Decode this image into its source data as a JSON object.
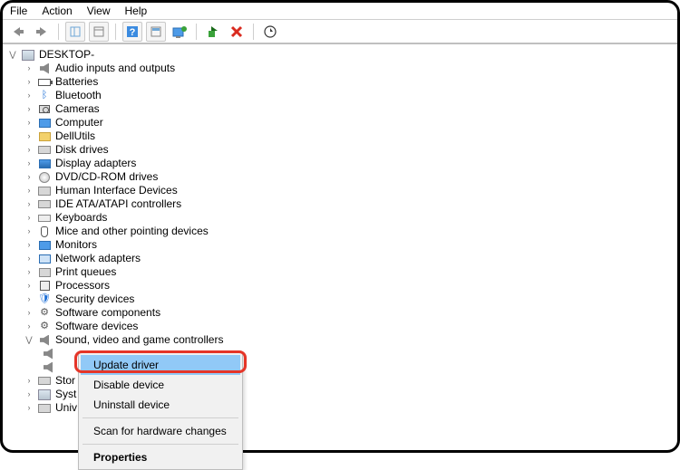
{
  "menubar": {
    "file": "File",
    "action": "Action",
    "view": "View",
    "help": "Help"
  },
  "root": "DESKTOP-",
  "categories": [
    "Audio inputs and outputs",
    "Batteries",
    "Bluetooth",
    "Cameras",
    "Computer",
    "DellUtils",
    "Disk drives",
    "Display adapters",
    "DVD/CD-ROM drives",
    "Human Interface Devices",
    "IDE ATA/ATAPI controllers",
    "Keyboards",
    "Mice and other pointing devices",
    "Monitors",
    "Network adapters",
    "Print queues",
    "Processors",
    "Security devices",
    "Software components",
    "Software devices",
    "Sound, video and game controllers"
  ],
  "truncated": [
    "Stor",
    "Syst",
    "Univ"
  ],
  "context_menu": {
    "update": "Update driver",
    "disable": "Disable device",
    "uninstall": "Uninstall device",
    "scan": "Scan for hardware changes",
    "properties": "Properties"
  }
}
